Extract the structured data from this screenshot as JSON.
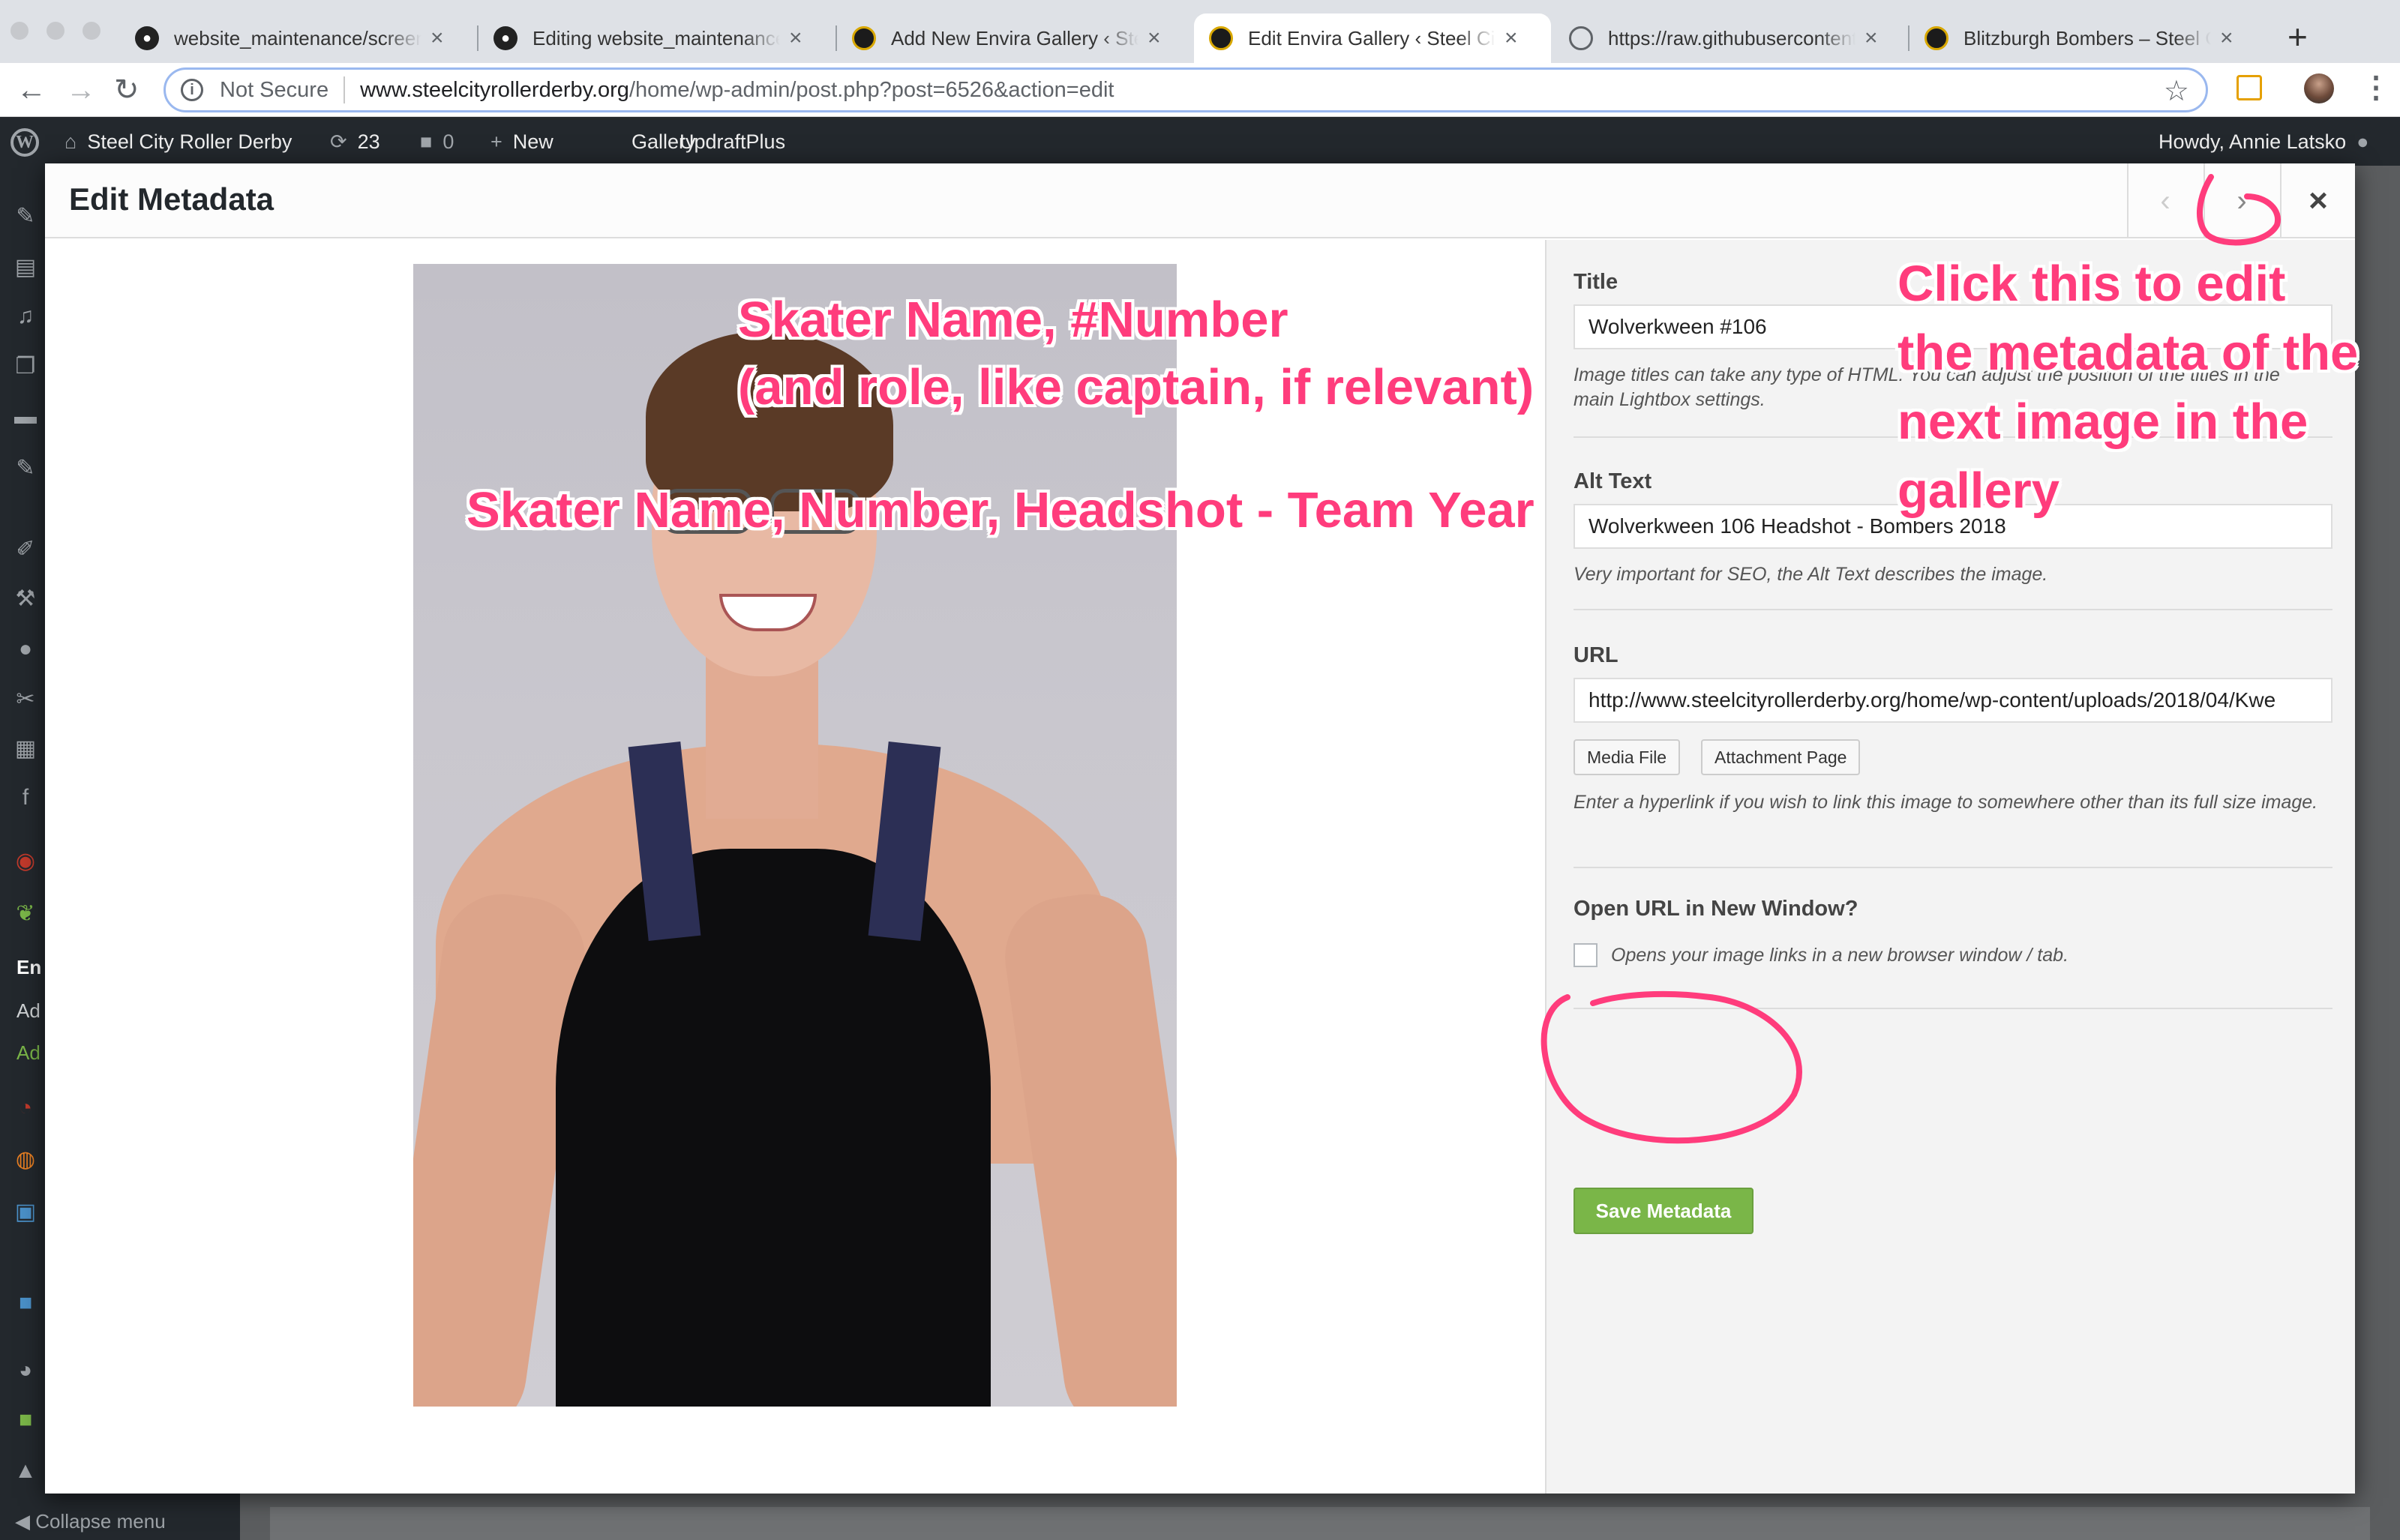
{
  "browser": {
    "tabs": [
      {
        "title": "website_maintenance/screenshots",
        "icon": "github-icon"
      },
      {
        "title": "Editing website_maintenance/upload",
        "icon": "github-icon"
      },
      {
        "title": "Add New Envira Gallery ‹ Steel City",
        "icon": "scrd-logo-icon"
      },
      {
        "title": "Edit Envira Gallery ‹ Steel City Roller",
        "icon": "scrd-logo-icon",
        "active": true
      },
      {
        "title": "https://raw.githubusercontent.com",
        "icon": "document-icon"
      },
      {
        "title": "Blitzburgh Bombers – Steel City",
        "icon": "scrd-logo-icon"
      }
    ],
    "close_glyph": "×",
    "new_tab_glyph": "+",
    "address": {
      "security": "Not Secure",
      "host": "www.steelcityrollerderby.org",
      "path": "/home/wp-admin/post.php?post=6526&action=edit"
    }
  },
  "adminbar": {
    "site_name": "Steel City Roller Derby",
    "updates_count": "23",
    "comments_count": "0",
    "new_label": "New",
    "gallery_label": "Gallery",
    "updraft_label": "UpdraftPlus",
    "greeting": "Howdy, Annie Latsko"
  },
  "sidebar": {
    "partial_labels": [
      "En",
      "Ad",
      "Ad"
    ],
    "collapse_label": "Collapse menu"
  },
  "modal": {
    "title": "Edit Metadata",
    "prev_glyph": "‹",
    "next_glyph": "›",
    "close_glyph": "×",
    "fields": {
      "title_label": "Title",
      "title_value": "Wolverkween #106",
      "title_help": "Image titles can take any type of HTML. You can adjust the position of the titles in the main Lightbox settings.",
      "alt_label": "Alt Text",
      "alt_value": "Wolverkween 106 Headshot - Bombers 2018",
      "alt_help": "Very important for SEO, the Alt Text describes the image.",
      "url_label": "URL",
      "url_value": "http://www.steelcityrollerderby.org/home/wp-content/uploads/2018/04/Kwe",
      "media_file_label": "Media File",
      "attachment_page_label": "Attachment Page",
      "url_help": "Enter a hyperlink if you wish to link this image to somewhere other than its full size image.",
      "new_window_label": "Open URL in New Window?",
      "new_window_help": "Opens your image links in a new browser window / tab.",
      "new_window_checked": false,
      "save_label": "Save Metadata"
    }
  },
  "annotations": {
    "title_hint_line1": "Skater Name, #Number",
    "title_hint_line2": "(and role, like captain, if relevant)",
    "alt_hint": "Skater Name, Number, Headshot - Team Year",
    "next_hint_lines": [
      "Click this to edit",
      "the metadata of the",
      "next image in the",
      "gallery"
    ],
    "color": "#ff3c7c"
  }
}
